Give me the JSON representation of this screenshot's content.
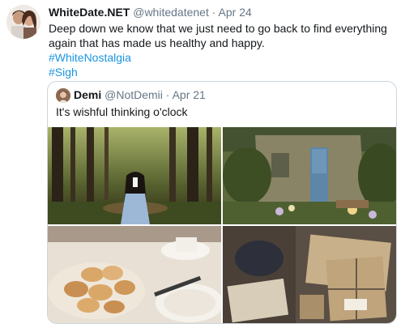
{
  "tweet": {
    "display_name": "WhiteDate.NET",
    "handle": "@whitedatenet",
    "separator": "·",
    "date": "Apr 24",
    "text": "Deep down we know that we just need to go back to find everything again that has made us healthy and happy.",
    "hashtags": [
      "#WhiteNostalgia",
      "#Sigh"
    ]
  },
  "quoted": {
    "display_name": "Demi",
    "handle": "@NotDemii",
    "separator": "·",
    "date": "Apr 21",
    "text": "It's wishful thinking o'clock"
  },
  "colors": {
    "link": "#1b95e0",
    "secondary_text": "#657786",
    "border": "#ccd6dd"
  }
}
